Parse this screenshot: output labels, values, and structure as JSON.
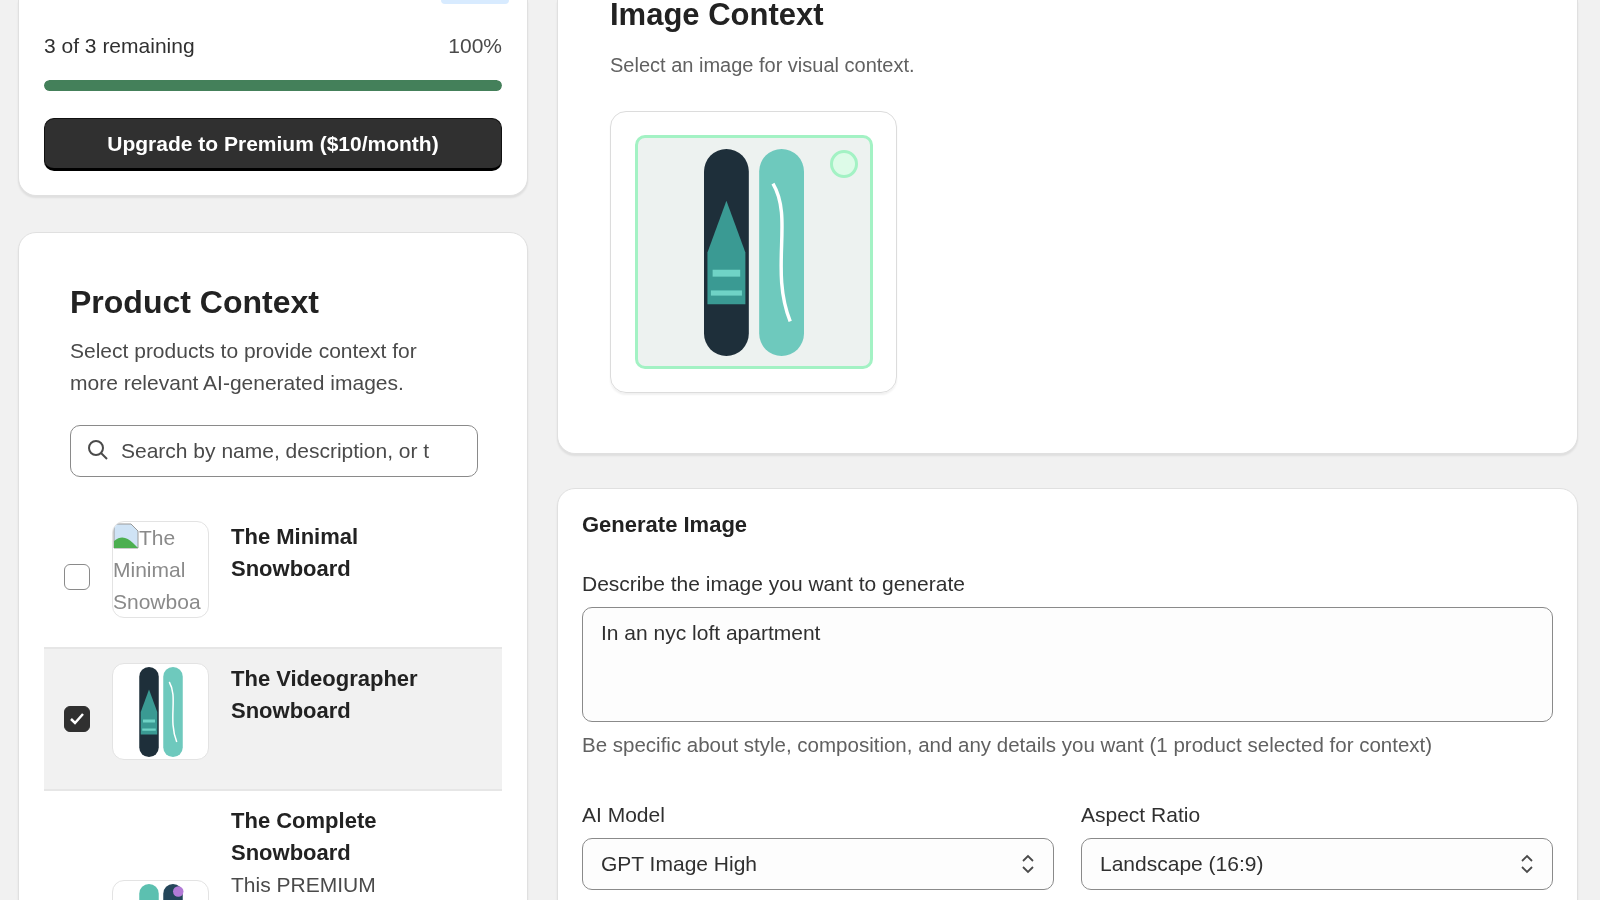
{
  "usage_card": {
    "remaining_text": "3 of 3 remaining",
    "percent_text": "100%",
    "progress": {
      "level": 1.0
    },
    "upgrade_button": "Upgrade to Premium ($10/month)"
  },
  "product_context": {
    "title": "Product Context",
    "description": "Select products to provide context for more relevant AI-generated images.",
    "search": {
      "placeholder": "Search by name, description, or t"
    },
    "products": [
      {
        "name": "The Minimal Snowboard",
        "checked": false,
        "selected": false,
        "image": {
          "kind": "broken",
          "alt": "The Minimal Snowboa"
        }
      },
      {
        "name": "The Videographer Snowboard",
        "checked": true,
        "selected": true,
        "image": {
          "kind": "hydrogen"
        }
      },
      {
        "name": "The Complete Snowboard",
        "description": "This PREMIUM",
        "selected": false,
        "image": {
          "kind": "complete"
        }
      }
    ]
  },
  "image_context": {
    "title": "Image Context",
    "subtitle": "Select an image for visual context.",
    "images": [
      {
        "kind": "hydrogen",
        "selected": true
      }
    ]
  },
  "generate": {
    "title": "Generate Image",
    "prompt_label": "Describe the image you want to generate",
    "prompt_value": "In an nyc loft apartment",
    "help": "Be specific about style, composition, and any details you want (1 product selected for context)",
    "selects": [
      {
        "label": "AI Model",
        "value": "GPT Image High"
      },
      {
        "label": "Aspect Ratio",
        "value": "Landscape (16:9)"
      }
    ]
  }
}
